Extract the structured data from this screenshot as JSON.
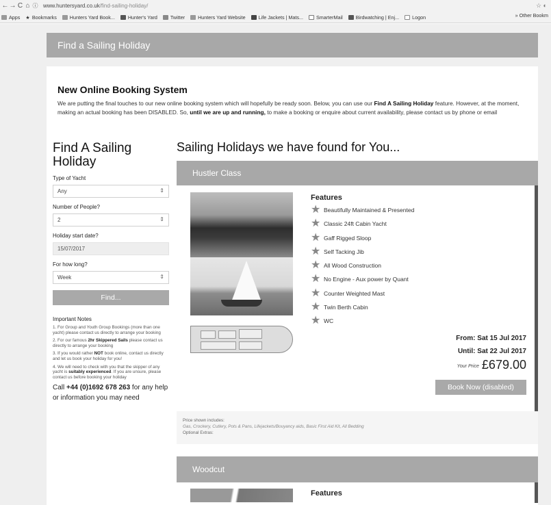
{
  "browser": {
    "url_host": "www.huntersyard.co.uk",
    "url_path": "/find-sailing-holiday/",
    "bookmarks": [
      {
        "label": "Apps",
        "icon": "apps-grid-icon"
      },
      {
        "label": "Bookmarks",
        "icon": "star-icon"
      },
      {
        "label": "Hunters Yard Book...",
        "icon": "folder-icon"
      },
      {
        "label": "Hunter's Yard",
        "icon": "facebook-icon"
      },
      {
        "label": "Twitter",
        "icon": "twitter-icon"
      },
      {
        "label": "Hunters Yard Website",
        "icon": "site-icon"
      },
      {
        "label": "Life Jackets | Mats...",
        "icon": "site-icon"
      },
      {
        "label": "SmarterMail",
        "icon": "mail-icon"
      },
      {
        "label": "Birdwatching | Enj...",
        "icon": "site-icon"
      },
      {
        "label": "Logon",
        "icon": "page-icon"
      }
    ],
    "other_bookmarks": "» Other Bookm"
  },
  "header": {
    "title": "Find a Sailing Holiday"
  },
  "notice": {
    "title": "New Online Booking System",
    "p1": "We are putting the final touches to our new online booking system which will hopefully be ready soon. Below, you can use our ",
    "p1_bold": "Find A Sailing Holiday",
    "p2": " feature. However, at the moment, making an actual booking has been DISABLED. So, ",
    "p2_bold": "until we are up and running,",
    "p3": " to make a booking or enquire about current availability, please contact us by phone or email"
  },
  "search": {
    "title": "Find A Sailing Holiday",
    "type_label": "Type of Yacht",
    "type_value": "Any",
    "people_label": "Number of People?",
    "people_value": "2",
    "date_label": "Holiday start date?",
    "date_value": "15/07/2017",
    "length_label": "For how long?",
    "length_value": "Week",
    "find_button": "Find...",
    "notes_title": "Important Notes",
    "note1": "1. For Group and Youth Group Bookings (more than one yacht) please contact us directly to arrange your booking",
    "note2_a": "2. For our famous ",
    "note2_b": "2hr Skippered Sails",
    "note2_c": " please contact us directly to arrange your booking",
    "note3_a": "3. If you would rather ",
    "note3_b": "NOT",
    "note3_c": " book online, contact us directly and let us book your holiday for you!",
    "note4_a": "4. We will need to check with you that the skipper of any yacht is ",
    "note4_b": "suitably experienced",
    "note4_c": ". If you are unsure, please contact us before booking your holiday",
    "call_a": "Call ",
    "call_phone": "+44 (0)1692 678 263",
    "call_b": " for any help or information you may need"
  },
  "results": {
    "title": "Sailing Holidays we have found for You...",
    "boats": [
      {
        "name": "Hustler Class",
        "features_title": "Features",
        "features": [
          "Beautifully Maintained & Presented",
          "Classic 24ft Cabin Yacht",
          "Gaff Rigged Sloop",
          "Self Tacking Jib",
          "All Wood Construction",
          "No Engine - Aux power by Quant",
          "Counter Weighted Mast",
          "Twin Berth Cabin",
          "WC"
        ],
        "from": "From: Sat 15 Jul 2017",
        "until": "Until: Sat 22 Jul 2017",
        "price_label": "Your Price",
        "price": "£679.00",
        "book_button": "Book Now (disabled)",
        "includes_label": "Price shown includes:",
        "includes": "Gas, Crockery, Cutlery, Pots & Pans, Lifejackets/Bouyancy aids, Basic First Aid Kit, All Bedding",
        "optional": "Optional Extras:"
      },
      {
        "name": "Woodcut",
        "features_title": "Features"
      }
    ]
  }
}
